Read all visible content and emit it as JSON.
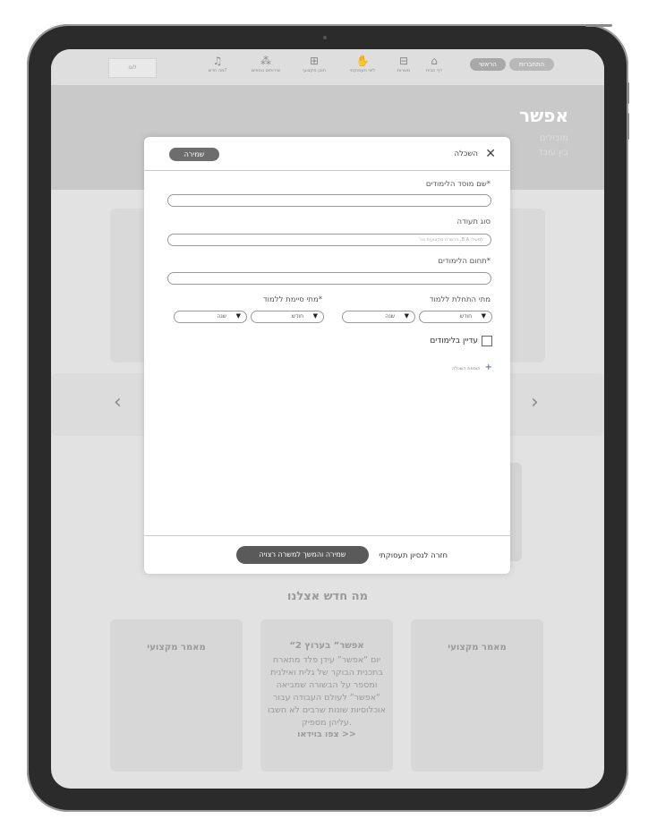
{
  "topbar": {
    "left_pills": [
      "התחברות",
      "הראשי"
    ],
    "nav": [
      {
        "label": "דף הבית",
        "icon": "home-icon",
        "glyph": "⌂"
      },
      {
        "label": "משרות",
        "icon": "briefcase-icon",
        "glyph": "⊟"
      },
      {
        "label": "ליווי תעסוקתי",
        "icon": "hand-icon",
        "glyph": "✋"
      },
      {
        "label": "תוכן מקצועי",
        "icon": "book-icon",
        "glyph": "⊞"
      },
      {
        "label": "שירותים נוספים",
        "icon": "apps-icon",
        "glyph": "⁂"
      },
      {
        "label": "מה חדש?",
        "icon": "bell-icon",
        "glyph": "♫"
      }
    ],
    "logo": "לוגו"
  },
  "hero": {
    "title": "אפשר",
    "subtitle_1": "מובילים",
    "subtitle_2": "בין עובד"
  },
  "section": {
    "whats_new": "מה חדש אצלנו"
  },
  "news": [
    {
      "title": "מאמר מקצועי",
      "body": ""
    },
    {
      "title": "“אפשר” בערוץ 2",
      "body": "יום “אפשר” עידן פלד מתארח בתכנית הבוקר של גלית ואילנית ומספר על הבשורה שמביאה “אפשר” לעולם העבודה עבור אוכלוסיות שונות שרבים לא חשבו עליהן מספיק.",
      "link": "צפו בוידאו >>"
    },
    {
      "title": "מאמר מקצועי",
      "body": ""
    }
  ],
  "modal": {
    "title": "השכלה",
    "save": "שמירה",
    "institution_label": "*שם מוסד הלימודים",
    "certificate_label": "סוג תעודה",
    "certificate_placeholder": "למשל: B.A, הכשרה מקצועית וכו'",
    "field_label": "*תחום הלימודים",
    "start_label": "מתי התחלת ללמוד",
    "end_label": "*מתי סיימת ללמוד",
    "month": "חודש",
    "year": "שנה",
    "still_studying": "עדיין בלימודים",
    "add_education": "הוספת השכלה",
    "save_continue": "שמירה והמשך למשרה רצויה",
    "back_link": "חזרה לנסיון תעסוקתי"
  }
}
